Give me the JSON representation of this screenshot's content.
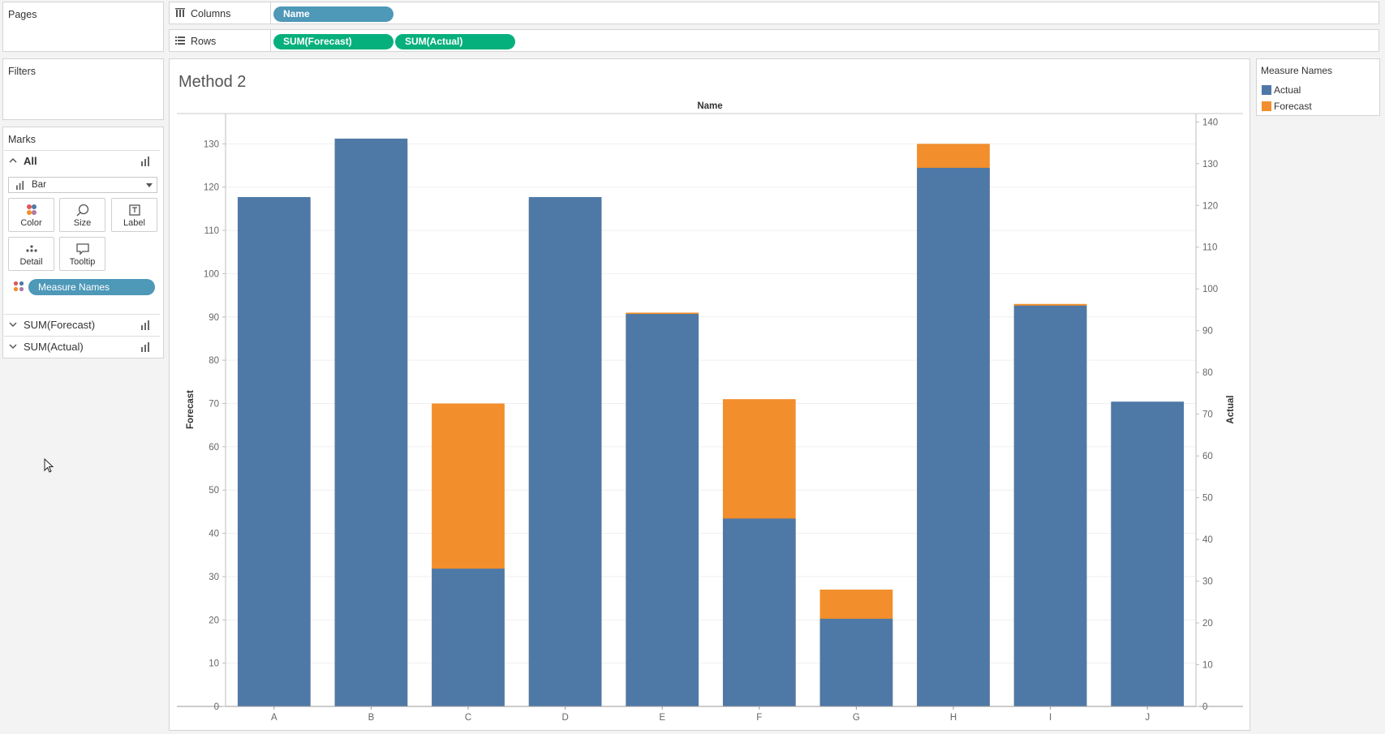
{
  "pages": {
    "title": "Pages"
  },
  "filters": {
    "title": "Filters"
  },
  "shelves": {
    "columns": {
      "label": "Columns",
      "pills": [
        "Name"
      ]
    },
    "rows": {
      "label": "Rows",
      "pills": [
        "SUM(Forecast)",
        "SUM(Actual)"
      ]
    }
  },
  "marks": {
    "title": "Marks",
    "all_label": "All",
    "mark_type": "Bar",
    "buttons": {
      "color": "Color",
      "size": "Size",
      "label": "Label",
      "detail": "Detail",
      "tooltip": "Tooltip"
    },
    "color_pill": "Measure Names",
    "cards": [
      "SUM(Forecast)",
      "SUM(Actual)"
    ]
  },
  "legend": {
    "title": "Measure Names",
    "items": [
      {
        "label": "Actual",
        "color": "#4e79a7"
      },
      {
        "label": "Forecast",
        "color": "#f28e2b"
      }
    ]
  },
  "chart_data": {
    "type": "bar",
    "title": "Method 2",
    "column_header": "Name",
    "categories": [
      "A",
      "B",
      "C",
      "D",
      "E",
      "F",
      "G",
      "H",
      "I",
      "J"
    ],
    "series": [
      {
        "name": "Forecast",
        "axis": "left",
        "color": "#f28e2b",
        "values": [
          117,
          130,
          70,
          117,
          91,
          71,
          27,
          130,
          93,
          70
        ]
      },
      {
        "name": "Actual",
        "axis": "right",
        "color": "#4e79a7",
        "values": [
          122,
          136,
          33,
          122,
          94,
          45,
          21,
          129,
          96,
          73
        ]
      }
    ],
    "ylabel": "Forecast",
    "y2label": "Actual",
    "ylim": [
      0,
      137
    ],
    "y2lim": [
      0,
      142
    ],
    "yticks": [
      0,
      10,
      20,
      30,
      40,
      50,
      60,
      70,
      80,
      90,
      100,
      110,
      120,
      130
    ],
    "y2ticks": [
      0,
      10,
      20,
      30,
      40,
      50,
      60,
      70,
      80,
      90,
      100,
      110,
      120,
      130,
      140
    ],
    "grid": true,
    "legend_position": "right"
  }
}
